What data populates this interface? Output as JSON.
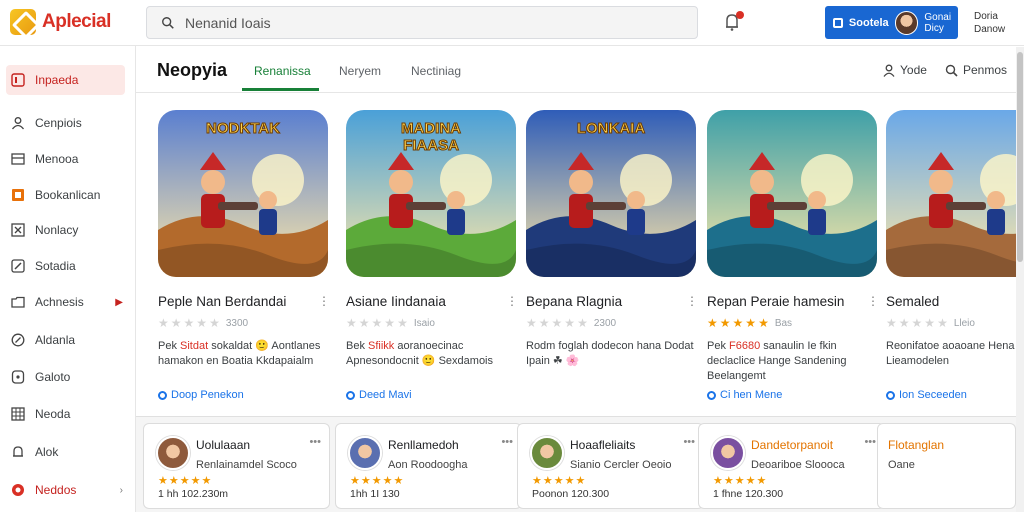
{
  "app": {
    "title": "Aplecial"
  },
  "search": {
    "placeholder": "Nenanid Ioais"
  },
  "account": {
    "button_label": "Sootela",
    "name": "Gonai Dicy"
  },
  "user": {
    "line1": "Doria",
    "line2": "Danow"
  },
  "sidebar": {
    "items": [
      {
        "label": "Inpaeda",
        "icon": "library-icon",
        "active": true
      },
      {
        "label": "Cenpiois",
        "icon": "user-icon"
      },
      {
        "label": "Menooa",
        "icon": "list-icon"
      },
      {
        "label": "Bookanlican",
        "icon": "book-icon"
      },
      {
        "label": "Nonlacy",
        "icon": "grid-x-icon"
      },
      {
        "label": "Sotadia",
        "icon": "edit-icon"
      },
      {
        "label": "Achnesis",
        "icon": "folder-icon",
        "arrow": true
      },
      {
        "label": "Aldanla",
        "icon": "compass-icon"
      },
      {
        "label": "Galoto",
        "icon": "tablet-icon"
      },
      {
        "label": "Neoda",
        "icon": "table-icon"
      },
      {
        "label": "Alok",
        "icon": "bell-icon"
      },
      {
        "label": "Neddos",
        "icon": "record-icon",
        "arrow": true
      }
    ]
  },
  "main": {
    "title": "Neopyia",
    "tabs": [
      {
        "label": "Renanissa",
        "active": true
      },
      {
        "label": "Neryem"
      },
      {
        "label": "Nectiniag"
      }
    ],
    "actions": [
      {
        "label": "Yode",
        "icon": "person-icon"
      },
      {
        "label": "Penmos",
        "icon": "search-icon"
      }
    ]
  },
  "games": [
    {
      "art_title": "NODKTAK",
      "title": "Peple Nan Berdandai",
      "stars": 0,
      "rating_text": "3300",
      "desc_prefix": "Pek",
      "desc_highlight": "Sitdat",
      "desc_rest": " sokaldat 🙂 Aontlanes hamakon en Boatia Kkdapaialm",
      "link": "Doop Penekon",
      "colors": {
        "sky": "#5a7fd0",
        "ground": "#b36a2c"
      }
    },
    {
      "art_title": "MADINA FIAASA",
      "title": "Asiane Iindanaia",
      "stars": 0,
      "rating_text": "Isaio",
      "desc_prefix": "Bek",
      "desc_highlight": "Sfiikk",
      "desc_rest": " aoranoecinac Apnesondocnit 🙂 Sexdamois",
      "link": "Deed Mavi",
      "colors": {
        "sky": "#4aa0d8",
        "ground": "#5caa3a"
      }
    },
    {
      "art_title": "LONKAIA",
      "title": "Bepana Rlagnia",
      "stars": 0,
      "rating_text": "2300",
      "desc_prefix": "Rodm",
      "desc_highlight": "",
      "desc_rest": " foglah dodecon hana Dodat Ipain ☘ 🌸",
      "link": "",
      "colors": {
        "sky": "#2f5db8",
        "ground": "#1f3a7a"
      }
    },
    {
      "art_title": "",
      "title": "Repan Peraie hamesin",
      "stars": 5,
      "rating_text": "Bas",
      "desc_prefix": "Pek",
      "desc_highlight": "F6680",
      "desc_rest": " sanaulin Ie fkin declaclice Hange Sandening Beelangemt",
      "link": "Ci hen Mene",
      "colors": {
        "sky": "#3fa0a8",
        "ground": "#1d6f8c"
      }
    },
    {
      "art_title": "",
      "title": "Semaled",
      "stars": 0,
      "rating_text": "Lleio",
      "desc_prefix": "Reonifatoe",
      "desc_highlight": "",
      "desc_rest": " aoaoane Hena Iso Lieamodelen",
      "link": "Ion Seceeden",
      "colors": {
        "sky": "#6aa8e8",
        "ground": "#a56a3c"
      }
    }
  ],
  "mini_cards": [
    {
      "title": "Uolulaaan",
      "sub": "Renlainamdel Scoco",
      "stars": 5,
      "meta": "1 hh 102.230m"
    },
    {
      "title": "Renllamedoh",
      "sub": "Aon Roodoogha",
      "stars": 5,
      "meta": "1hh 1I 130"
    },
    {
      "title": "Hoaafleliaits",
      "sub": "Sianio Cercler Oeoio",
      "stars": 5,
      "meta": "Poonon 120.300"
    },
    {
      "title": "Dandetorpanoit",
      "sub": "Deoariboe Sloooca",
      "stars": 5,
      "meta": "1 fhne 120.300"
    },
    {
      "title": "Flotanglan",
      "sub": "Oane",
      "stars": 0,
      "meta": ""
    }
  ],
  "colors": {
    "accent": "#1967d2",
    "brand_red": "#d93025",
    "tab_green": "#188038",
    "star": "#f29900"
  }
}
